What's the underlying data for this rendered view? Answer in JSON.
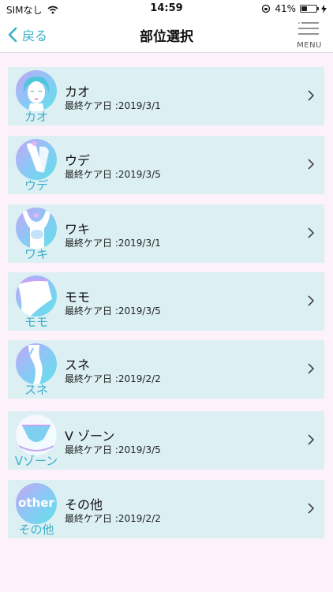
{
  "status_bar": {
    "carrier": "SIMなし",
    "time": "14:59",
    "battery_percent": "41%",
    "battery_level": 0.41
  },
  "nav": {
    "back_label": "戻る",
    "title": "部位選択",
    "menu_label": "MENU"
  },
  "parts": [
    {
      "name": "カオ",
      "icon_label": "カオ",
      "last_care": "最終ケア日 :2019/3/1",
      "icon": "face-icon"
    },
    {
      "name": "ウデ",
      "icon_label": "ウデ",
      "last_care": "最終ケア日 :2019/3/5",
      "icon": "arm-icon"
    },
    {
      "name": "ワキ",
      "icon_label": "ワキ",
      "last_care": "最終ケア日 :2019/3/1",
      "icon": "armpit-icon"
    },
    {
      "name": "モモ",
      "icon_label": "モモ",
      "last_care": "最終ケア日 :2019/3/5",
      "icon": "thigh-icon"
    },
    {
      "name": "スネ",
      "icon_label": "スネ",
      "last_care": "最終ケア日 :2019/2/2",
      "icon": "shin-icon"
    },
    {
      "name": "V ゾーン",
      "icon_label": "Vゾーン",
      "last_care": "最終ケア日 :2019/3/5",
      "icon": "v-zone-icon"
    },
    {
      "name": "その他",
      "icon_label": "その他",
      "last_care": "最終ケア日 :2019/2/2",
      "icon": "other-icon",
      "icon_text": "other"
    }
  ],
  "colors": {
    "accent": "#3aaec9",
    "card_bg": "#dcf0f4",
    "page_bg": "#fdf1fb"
  }
}
